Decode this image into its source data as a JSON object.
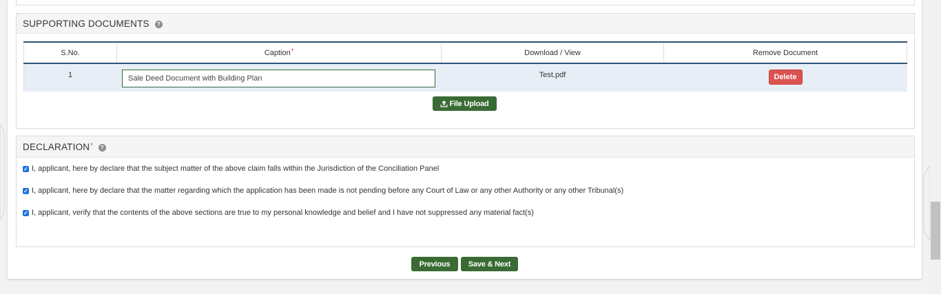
{
  "supporting_documents": {
    "title": "SUPPORTING DOCUMENTS",
    "help_icon_symbol": "?",
    "table": {
      "headers": {
        "sno": "S.No.",
        "caption": "Caption",
        "caption_required": "*",
        "download": "Download / View",
        "remove": "Remove Document"
      },
      "rows": [
        {
          "sno": "1",
          "caption": "Sale Deed Document with Building Plan",
          "file": "Test.pdf",
          "delete_label": "Delete"
        }
      ]
    },
    "upload_icon": "upload-icon",
    "upload_label": "File Upload"
  },
  "declaration": {
    "title": "DECLARATION",
    "required": "*",
    "help_icon_symbol": "?",
    "items": [
      {
        "text": "I, applicant, here by declare that the subject matter of the above claim falls within the Jurisdiction of the Conciliation Panel",
        "checked": true
      },
      {
        "text": "I, applicant, here by declare that the matter regarding which the application has been made is not pending before any Court of Law or any other Authority or any other Tribunal(s)",
        "checked": true
      },
      {
        "text": "I, applicant, verify that the contents of the above sections are true to my personal knowledge and belief and I have not suppressed any material fact(s)",
        "checked": true
      }
    ]
  },
  "footer": {
    "previous_label": "Previous",
    "save_next_label": "Save & Next"
  },
  "colors": {
    "primary_green": "#3a6b34",
    "danger_red": "#d9534f",
    "table_header_border": "#2c5376",
    "row_highlight": "#e7eef6",
    "checkbox_blue": "#1e73d8"
  }
}
